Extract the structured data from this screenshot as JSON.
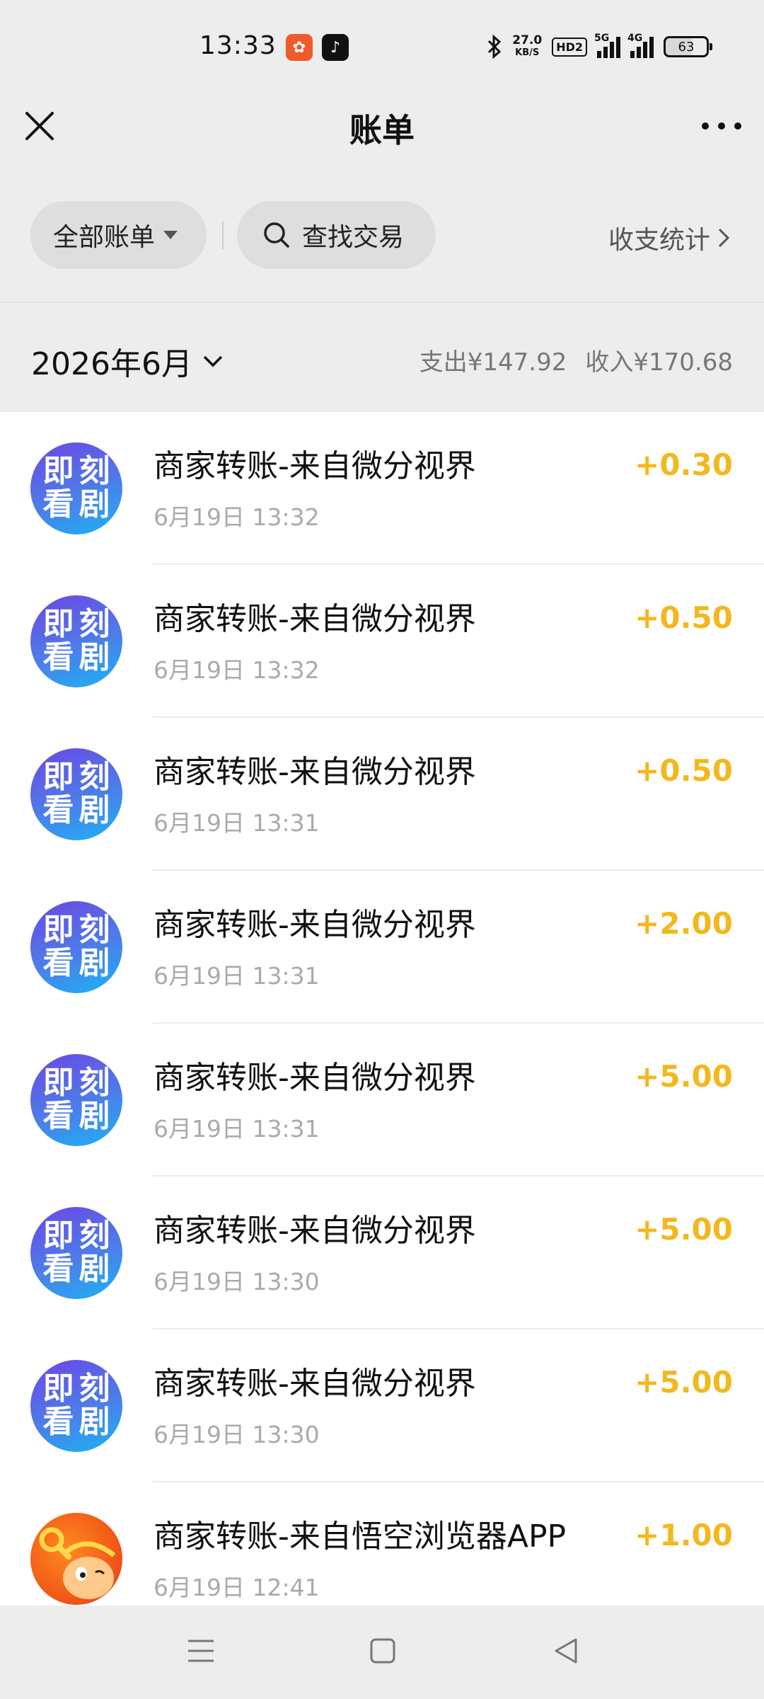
{
  "status_bar": {
    "time": "13:33",
    "speed_value": "27.0",
    "speed_unit": "KB/S",
    "hd_label": "HD2",
    "signal_1": "5G",
    "signal_2": "4G",
    "battery": "63"
  },
  "nav": {
    "title": "账单",
    "close_icon": "close-icon",
    "more_icon": "more-icon"
  },
  "filters": {
    "all_bills": "全部账单",
    "search": "查找交易",
    "stats": "收支统计"
  },
  "month": {
    "label": "2026年6月",
    "expense": "支出¥147.92",
    "income": "收入¥170.68"
  },
  "transactions": [
    {
      "avatar": [
        "即",
        "刻",
        "看",
        "剧"
      ],
      "title": "商家转账-来自微分视界",
      "time": "6月19日 13:32",
      "amount": "+0.30"
    },
    {
      "avatar": [
        "即",
        "刻",
        "看",
        "剧"
      ],
      "title": "商家转账-来自微分视界",
      "time": "6月19日 13:32",
      "amount": "+0.50"
    },
    {
      "avatar": [
        "即",
        "刻",
        "看",
        "剧"
      ],
      "title": "商家转账-来自微分视界",
      "time": "6月19日 13:31",
      "amount": "+0.50"
    },
    {
      "avatar": [
        "即",
        "刻",
        "看",
        "剧"
      ],
      "title": "商家转账-来自微分视界",
      "time": "6月19日 13:31",
      "amount": "+2.00"
    },
    {
      "avatar": [
        "即",
        "刻",
        "看",
        "剧"
      ],
      "title": "商家转账-来自微分视界",
      "time": "6月19日 13:31",
      "amount": "+5.00"
    },
    {
      "avatar": [
        "即",
        "刻",
        "看",
        "剧"
      ],
      "title": "商家转账-来自微分视界",
      "time": "6月19日 13:30",
      "amount": "+5.00"
    },
    {
      "avatar": [
        "即",
        "刻",
        "看",
        "剧"
      ],
      "title": "商家转账-来自微分视界",
      "time": "6月19日 13:30",
      "amount": "+5.00"
    },
    {
      "avatar": [],
      "title": "商家转账-来自悟空浏览器APP",
      "time": "6月19日 12:41",
      "amount": "+1.00"
    }
  ],
  "colors": {
    "income_amount": "#f2b81e",
    "background": "#ededed",
    "list_background": "#ffffff"
  }
}
